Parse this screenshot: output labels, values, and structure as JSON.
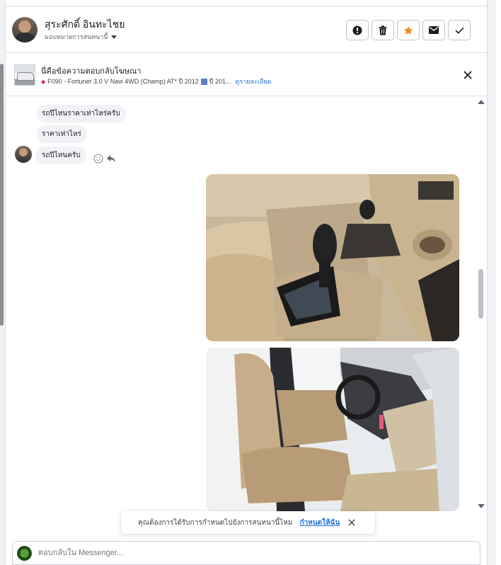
{
  "header": {
    "user_name": "สุระศักดิ์ อินทะไชย",
    "assign_label": "มอบหมายการสนทนานี้",
    "actions": [
      {
        "name": "report-button",
        "icon": "alert-circle-icon"
      },
      {
        "name": "delete-button",
        "icon": "trash-icon"
      },
      {
        "name": "star-button",
        "icon": "star-icon"
      },
      {
        "name": "mark-unread-button",
        "icon": "envelope-icon"
      },
      {
        "name": "done-button",
        "icon": "check-icon"
      }
    ]
  },
  "ad": {
    "title": "นี่คือข้อความตอบกลับโฆษณา",
    "subtitle": "F090 - Fortuner 3.0 V Navi 4WD (Champ) AT* ปี 2012",
    "subtitle_extra": "ปี 201...",
    "details_link": "ดูรายละเอียด"
  },
  "messages": [
    {
      "text": "รถปีไหนราคาเท่าไหร่ครับ"
    },
    {
      "text": "ราคาเท่าไหร่"
    },
    {
      "text": "รถปีไหนครับ"
    }
  ],
  "notification": {
    "text": "คุณต้องการได้รับการกำหนดไปยังการสนทนานี้ไหม",
    "action": "กำหนดให้ฉัน"
  },
  "composer": {
    "placeholder": "ตอบกลับใน Messenger..."
  },
  "colors": {
    "accent_blue": "#216fdb",
    "star_orange": "#f5821f",
    "bubble_bg": "#f0f2f5"
  }
}
